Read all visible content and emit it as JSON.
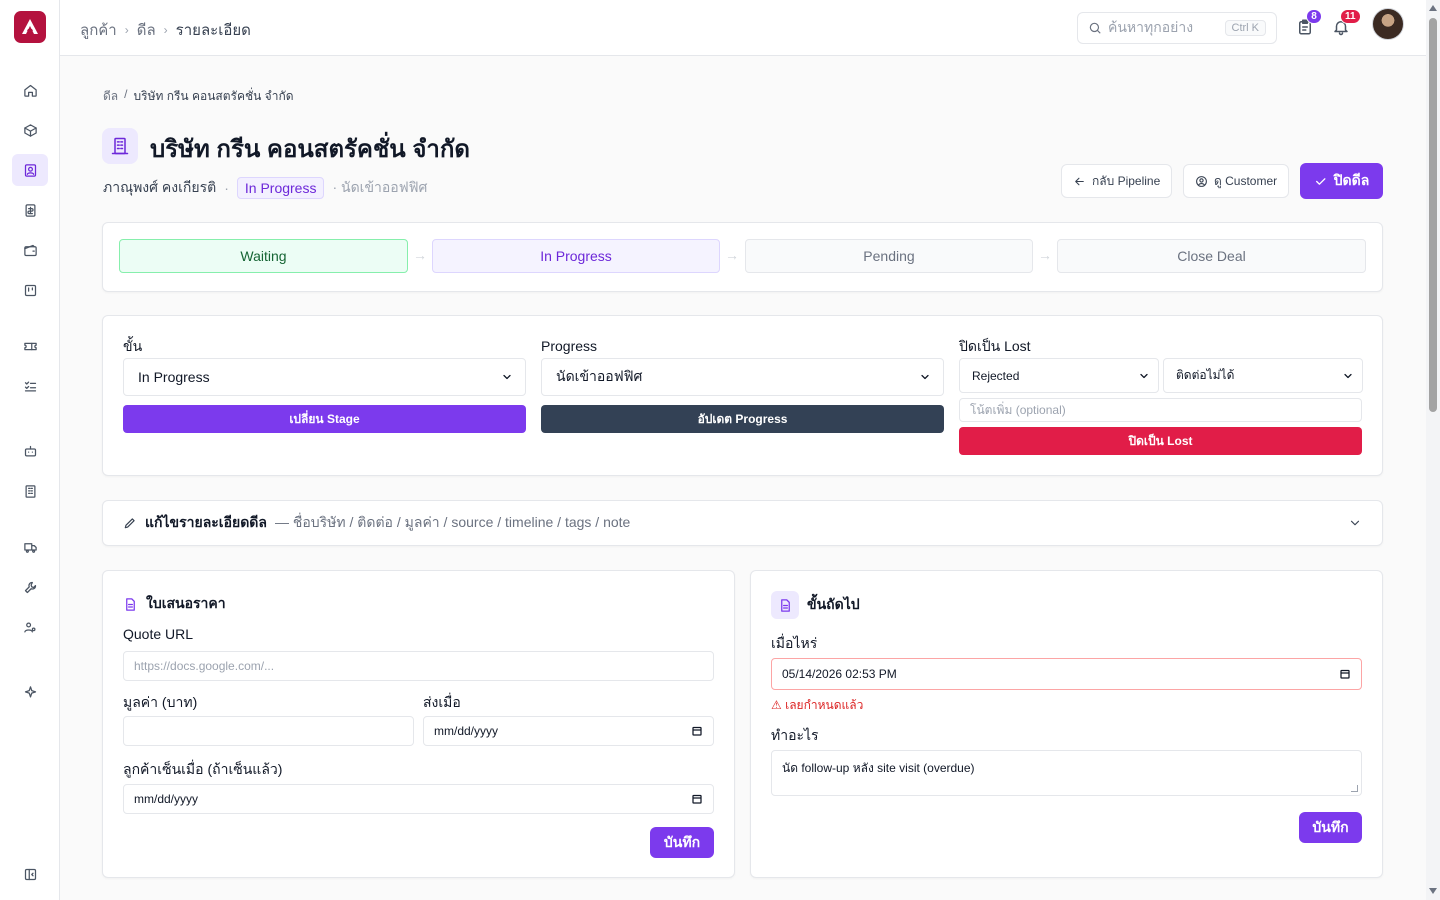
{
  "topbar": {
    "breadcrumb": [
      "ลูกค้า",
      "ดีล",
      "รายละเอียด"
    ],
    "search_placeholder": "ค้นหาทุกอย่าง",
    "search_shortcut": "Ctrl K",
    "tasks_badge": "8",
    "notif_badge": "11"
  },
  "sidebar": {
    "items": [
      "home-icon",
      "box-icon",
      "contact-icon",
      "invoice-icon",
      "wallet-icon",
      "board-icon",
      "ticket-icon",
      "checklist-icon",
      "bot-icon",
      "building-icon",
      "truck-icon",
      "wrench-icon",
      "users-icon",
      "sparkle-icon",
      "collapse-icon"
    ]
  },
  "page": {
    "breadcrumb": [
      "ดีล",
      "/",
      "บริษัท กรีน คอนสตรัคชั่น จำกัด"
    ],
    "title": "บริษัท กรีน คอนสตรัคชั่น จำกัด",
    "owner": "ภาณุพงศ์ คงเกียรติ",
    "status": "In Progress",
    "progress_note": "· นัดเข้าออฟฟิศ",
    "back_button": "กลับ Pipeline",
    "customer_button": "ดู Customer",
    "close_button": "ปิดดีล"
  },
  "stages": [
    "Waiting",
    "In Progress",
    "Pending",
    "Close Deal"
  ],
  "stage_form": {
    "stage_label": "ขั้น",
    "stage_value": "In Progress",
    "change_stage_button": "เปลี่ยน Stage",
    "progress_label": "Progress",
    "progress_value": "นัดเข้าออฟฟิศ",
    "update_progress_button": "อัปเดต Progress",
    "lost_label": "ปิดเป็น Lost",
    "lost_reason": "Rejected",
    "lost_detail": "ติดต่อไม่ได้",
    "lost_note_placeholder": "โน้ตเพิ่ม (optional)",
    "mark_lost_button": "ปิดเป็น Lost"
  },
  "edit_section": {
    "title": "แก้ไขรายละเอียดดีล",
    "subtitle": "— ชื่อบริษัท / ติดต่อ / มูลค่า / source / timeline / tags / note"
  },
  "quote": {
    "title": "ใบเสนอราคา",
    "url_label": "Quote URL",
    "url_placeholder": "https://docs.google.com/...",
    "value_label": "มูลค่า (บาท)",
    "value": "",
    "sent_label": "ส่งเมื่อ",
    "sent_value": "mm/dd/yyyy",
    "signed_label": "ลูกค้าเซ็นเมื่อ (ถ้าเซ็นแล้ว)",
    "signed_value": "mm/dd/yyyy",
    "save_button": "บันทึก"
  },
  "next_step": {
    "title": "ขั้นถัดไป",
    "when_label": "เมื่อไหร่",
    "when_value": "05/14/2026 02:53 PM",
    "overdue_warning": "⚠ เลยกำหนดแล้ว",
    "what_label": "ทำอะไร",
    "what_value": "นัด follow-up หลัง site visit (overdue)",
    "save_button": "บันทึก"
  },
  "colors": {
    "accent": "#7c3aed",
    "danger": "#e11d48",
    "dark": "#334155",
    "brand": "#b4123e"
  }
}
